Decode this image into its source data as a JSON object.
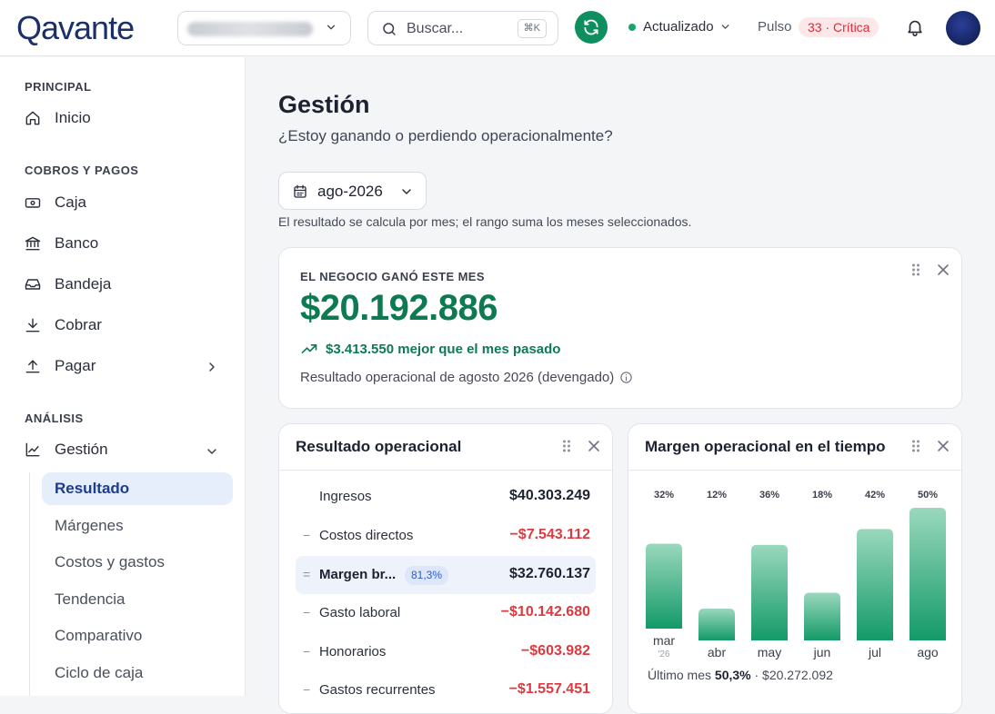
{
  "brand": {
    "name": "Qavante"
  },
  "header": {
    "search_placeholder": "Buscar...",
    "search_shortcut": "⌘K",
    "status": "Actualizado",
    "pulse_label": "Pulso",
    "pulse_badge": "33 · Crítica"
  },
  "sidebar": {
    "sections": [
      {
        "label": "PRINCIPAL"
      },
      {
        "label": "COBROS Y PAGOS"
      },
      {
        "label": "ANÁLISIS"
      }
    ],
    "items": [
      {
        "label": "Inicio",
        "icon": "home-icon"
      },
      {
        "label": "Caja",
        "icon": "cash-icon"
      },
      {
        "label": "Banco",
        "icon": "bank-icon"
      },
      {
        "label": "Bandeja",
        "icon": "inbox-icon"
      },
      {
        "label": "Cobrar",
        "icon": "download-icon"
      },
      {
        "label": "Pagar",
        "icon": "upload-icon"
      },
      {
        "label": "Gestión",
        "icon": "chart-icon"
      }
    ],
    "subitems": [
      {
        "label": "Resultado",
        "active": true
      },
      {
        "label": "Márgenes"
      },
      {
        "label": "Costos y gastos"
      },
      {
        "label": "Tendencia"
      },
      {
        "label": "Comparativo"
      },
      {
        "label": "Ciclo de caja"
      }
    ]
  },
  "main": {
    "title": "Gestión",
    "subtitle": "¿Estoy ganando o perdiendo operacionalmente?",
    "period": "ago-2026",
    "period_note": "El resultado se calcula por mes; el rango suma los meses seleccionados."
  },
  "kpi": {
    "eyebrow": "EL NEGOCIO GANÓ ESTE MES",
    "value": "$20.192.886",
    "delta": "$3.413.550 mejor que el mes pasado",
    "footnote": "Resultado operacional de agosto 2026 (devengado)"
  },
  "result_card": {
    "title": "Resultado operacional",
    "rows": [
      {
        "sign": "",
        "label": "Ingresos",
        "value": "$40.303.249",
        "negative": false
      },
      {
        "sign": "−",
        "label": "Costos directos",
        "value": "−$7.543.112",
        "negative": true
      },
      {
        "sign": "=",
        "label": "Margen br...",
        "pill": "81,3%",
        "value": "$32.760.137",
        "negative": false,
        "highlight": true
      },
      {
        "sign": "−",
        "label": "Gasto laboral",
        "value": "−$10.142.680",
        "negative": true
      },
      {
        "sign": "−",
        "label": "Honorarios",
        "value": "−$603.982",
        "negative": true
      },
      {
        "sign": "−",
        "label": "Gastos recurrentes",
        "value": "−$1.557.451",
        "negative": true
      }
    ]
  },
  "chart_card": {
    "title": "Margen operacional en el tiempo",
    "footer_prefix": "Último mes",
    "footer_value": "50,3%",
    "footer_suffix": "· $20.272.092"
  },
  "chart_data": {
    "type": "bar",
    "categories": [
      "mar",
      "abr",
      "may",
      "jun",
      "jul",
      "ago"
    ],
    "year_labels": [
      "'26",
      "",
      "",
      "",
      "",
      ""
    ],
    "values": [
      32,
      12,
      36,
      18,
      42,
      50
    ],
    "value_labels": [
      "32%",
      "12%",
      "36%",
      "18%",
      "42%",
      "50%"
    ],
    "colors": {
      "bar_top": "#9ad8bd",
      "bar_bottom": "#139a68"
    }
  }
}
